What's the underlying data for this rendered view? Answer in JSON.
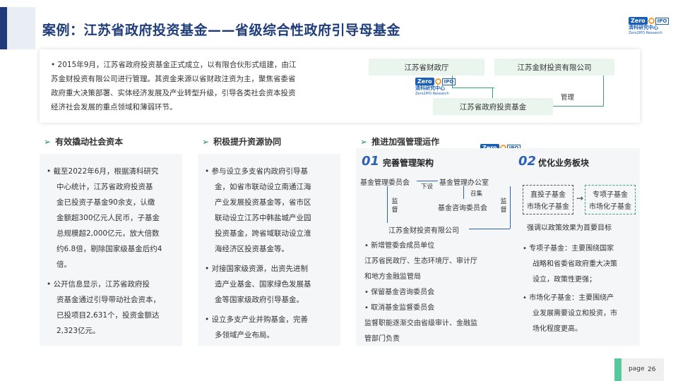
{
  "title": "案例：江苏省政府投资基金——省级综合性政府引导母基金",
  "logo": {
    "zero": "Zero",
    "ipo": "IPO",
    "cn": "清科研究中心",
    "en": "Zero2IPO Research"
  },
  "intro": {
    "lines": [
      "• 2015年9月，江苏省政府投资基金正式成立，以有限合伙形式组建，由江",
      "苏金财投资有限公司进行管理。其资金来源以省财政注资为主，聚焦省委省",
      "政府重大决策部署、实体经济发展及产业转型升级，引导各类社会资本投资",
      "经济社会发展的重点领域和薄弱环节。"
    ]
  },
  "org": {
    "finance": "江苏省财政厅",
    "jincai": "江苏金财投资有限公司",
    "fund": "江苏省政府投资基金",
    "manage": "管理"
  },
  "sections": {
    "s1": {
      "head": "有效撬动社会资本",
      "lines": [
        "• 截至2022年6月，根据清科研究",
        "中心统计，江苏省政府投资基",
        "金已投资子基金90余支，认缴",
        "金额超300亿元人民币，子基金",
        "总规模超2,000亿元，放大倍数",
        "约6.8倍，剔除国家级基金后约4",
        "倍。",
        "• 公开信息显示，江苏省政府投",
        "资基金通过引导带动社会资本，",
        "已投项目2,631个，投资金额达",
        "2,323亿元。"
      ]
    },
    "s2": {
      "head": "积极提升资源协同",
      "lines": [
        "• 参与设立多支省内政府引导基",
        "金，如省市联动设立南通江海",
        "产业发展投资基金等，省市区",
        "联动设立江苏中韩盐城产业园",
        "投资基金，跨省域联动设立淮",
        "海经济区投资基金等。",
        "• 对接国家级资源，出资先进制",
        "造产业基金、国家绿色发展基",
        "金等国家级政府引导基金。",
        "• 设立多支产业并购基金，完善",
        "多领域产业布局。"
      ]
    },
    "s3": {
      "head": "推进加强管理运作",
      "num1": "01",
      "sub1": "完善管理架构",
      "num2": "02",
      "sub2": "优化业务板块",
      "committee": "基金管理委员会",
      "office": "基金管理办公室",
      "xiada": "下设",
      "zhaoji": "召集",
      "advisory": "基金咨询委员会",
      "jiandu": "监督",
      "jincai": "江苏金财投资有限公司",
      "left_lines": [
        "• 新增管委会成员单位",
        "江苏省民政厅、生态环境厅、审计厅",
        "和地方金融监管局",
        "• 保留基金咨询委员会",
        "• 取消基金监督委员会",
        "监督职能逐渐交由省级审计、金融监",
        "管部门负责"
      ],
      "box1": [
        "直投子基金",
        "市场化子基金"
      ],
      "box2": [
        "专项子基金",
        "市场化子基金"
      ],
      "policy": "强调以政策效果为首要目标",
      "right_lines": [
        "• 专项子基金：主要围绕国家",
        "战略和省委省政府重大决策",
        "设立，政策性更强；",
        "• 市场化子基金：主要围绕产",
        "业发展需要设立和投资，市",
        "场化程度更高。"
      ]
    }
  },
  "footer": {
    "page_label": "page",
    "page_num": "26"
  }
}
